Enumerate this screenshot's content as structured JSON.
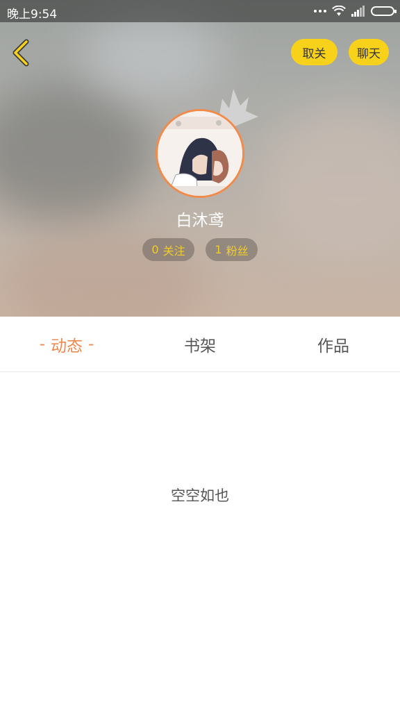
{
  "status_bar": {
    "time": "晚上9:54"
  },
  "profile": {
    "username": "白沐鸢",
    "following": {
      "count": "0",
      "label": "关注"
    },
    "fans": {
      "count": "1",
      "label": "粉丝"
    }
  },
  "actions": {
    "unfollow_label": "取关",
    "chat_label": "聊天"
  },
  "tabs": [
    {
      "label": "动态",
      "active": true
    },
    {
      "label": "书架",
      "active": false
    },
    {
      "label": "作品",
      "active": false
    }
  ],
  "active_tab_dash": "-",
  "empty_state": "空空如也",
  "colors": {
    "accent_orange": "#f0894f",
    "button_yellow": "#f8d21a",
    "stat_text": "#f2cd2a"
  }
}
